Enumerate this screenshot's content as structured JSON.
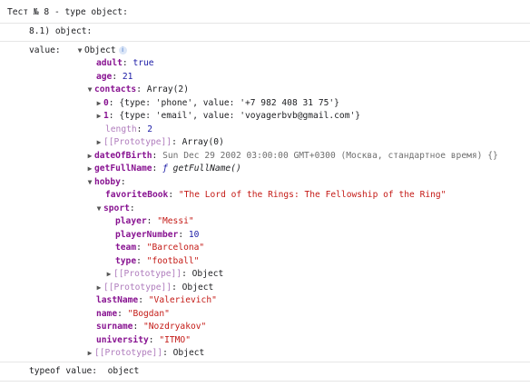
{
  "header": "Тест № 8 - type object:",
  "subheader": "8.1) object:",
  "value_label": "value:",
  "root_label": "Object",
  "info_icon": "i",
  "fields": {
    "adult_k": "adult",
    "adult_v": "true",
    "age_k": "age",
    "age_v": "21",
    "contacts_k": "contacts",
    "contacts_v": "Array(2)",
    "c0_k": "0",
    "c0_v": "{type: 'phone', value: '+7 982 408 31 75'}",
    "c1_k": "1",
    "c1_v": "{type: 'email', value: 'voyagerbvb@gmail.com'}",
    "length_k": "length",
    "length_v": "2",
    "proto_arr_k": "[[Prototype]]",
    "proto_arr_v": "Array(0)",
    "dob_k": "dateOfBirth",
    "dob_v": "Sun Dec 29 2002 03:00:00 GMT+0300 (Москва, стандартное время) {}",
    "getfull_k": "getFullName",
    "getfull_f": "ƒ",
    "getfull_v": "getFullName()",
    "hobby_k": "hobby",
    "book_k": "favoriteBook",
    "book_v": "\"The Lord of the Rings: The Fellowship of the Ring\"",
    "sport_k": "sport",
    "player_k": "player",
    "player_v": "\"Messi\"",
    "pnum_k": "playerNumber",
    "pnum_v": "10",
    "team_k": "team",
    "team_v": "\"Barcelona\"",
    "type_k": "type",
    "type_v": "\"football\"",
    "proto_sport_k": "[[Prototype]]",
    "proto_sport_v": "Object",
    "proto_hobby_k": "[[Prototype]]",
    "proto_hobby_v": "Object",
    "lastname_k": "lastName",
    "lastname_v": "\"Valerievich\"",
    "name_k": "name",
    "name_v": "\"Bogdan\"",
    "surname_k": "surname",
    "surname_v": "\"Nozdryakov\"",
    "uni_k": "university",
    "uni_v": "\"ITMO\"",
    "proto_root_k": "[[Prototype]]",
    "proto_root_v": "Object"
  },
  "footer_label": "typeof value:",
  "footer_value": "object",
  "arrows": {
    "down": "▼",
    "right": "▶"
  }
}
